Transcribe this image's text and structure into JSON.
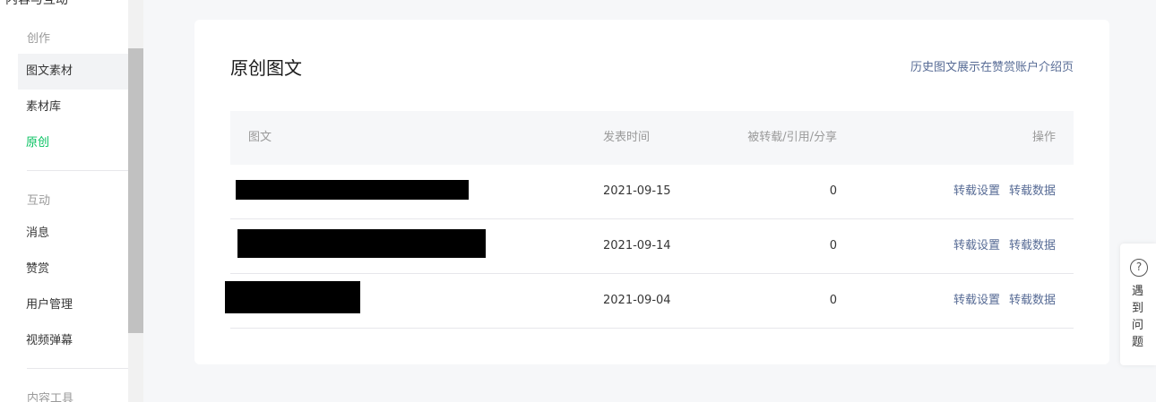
{
  "sidebar": {
    "top_partial": "内容与互动",
    "groups": {
      "create": "创作",
      "interact": "互动",
      "tools": "内容工具"
    },
    "items": [
      {
        "label": "图文素材"
      },
      {
        "label": "素材库"
      },
      {
        "label": "原创"
      },
      {
        "label": "消息"
      },
      {
        "label": "赞赏"
      },
      {
        "label": "用户管理"
      },
      {
        "label": "视频弹幕"
      }
    ]
  },
  "card": {
    "title": "原创图文",
    "link": "历史图文展示在赞赏账户介绍页"
  },
  "table": {
    "headers": {
      "article": "图文",
      "date": "发表时间",
      "shares": "被转载/引用/分享",
      "ops": "操作"
    },
    "rows": [
      {
        "date": "2021-09-15",
        "count": "0",
        "op1": "转载设置",
        "op2": "转载数据"
      },
      {
        "date": "2021-09-14",
        "count": "0",
        "op1": "转载设置",
        "op2": "转载数据"
      },
      {
        "date": "2021-09-04",
        "count": "0",
        "op1": "转载设置",
        "op2": "转载数据"
      }
    ]
  },
  "help": {
    "icon": "question-circle-icon",
    "icon_glyph": "?",
    "label": "遇到问题"
  },
  "colors": {
    "accent_green": "#07c160",
    "link_blue": "#576b95"
  }
}
